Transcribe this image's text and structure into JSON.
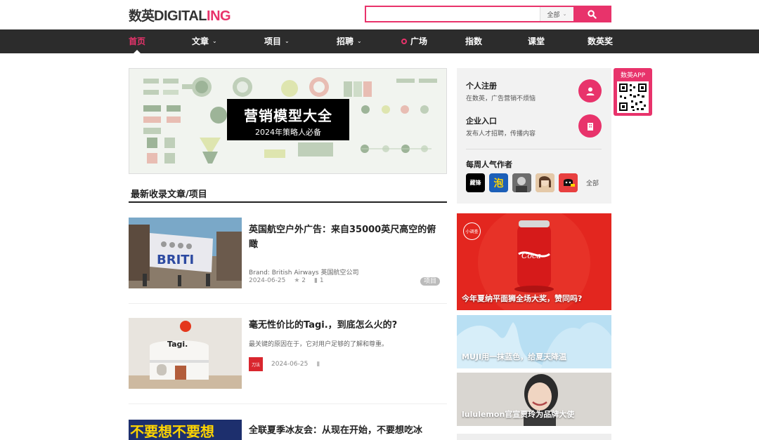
{
  "brand": {
    "logo_zh": "数英",
    "logo_en_a": "DIGITAL",
    "logo_en_b": "ING",
    "accent": "#e8336b"
  },
  "search": {
    "value": "",
    "placeholder": "",
    "scope": "全部"
  },
  "nav": [
    {
      "label": "首页",
      "active": true,
      "dropdown": false
    },
    {
      "label": "文章",
      "dropdown": true
    },
    {
      "label": "项目",
      "dropdown": true
    },
    {
      "label": "招聘",
      "dropdown": true
    },
    {
      "label": "广场",
      "dot": true
    },
    {
      "label": "指数"
    },
    {
      "label": "课堂"
    },
    {
      "label": "数英奖"
    }
  ],
  "banner": {
    "title": "营销模型大全",
    "subtitle": "2024年策略人必备"
  },
  "section_title": "最新收录文章/项目",
  "articles": [
    {
      "title": "英国航空户外广告：来自35000英尺高空的俯瞰",
      "brand_line": "Brand: British Airways 英国航空公司",
      "date": "2024-06-25",
      "likes": "2",
      "comments": "1",
      "tag": "项目"
    },
    {
      "title": "毫无性价比的Tagi.，到底怎么火的?",
      "excerpt": "最关键的原因在于，它对用户足够的了解和尊重。",
      "date": "2024-06-25",
      "source_logo": "刀法"
    },
    {
      "title": "全联夏季冰友会：从现在开始，不要想吃冰",
      "thumb_text": "不要想不要想"
    }
  ],
  "sidebar": {
    "register": {
      "title": "个人注册",
      "sub": "在数英，广告营销不烦恼"
    },
    "enterprise": {
      "title": "企业入口",
      "sub": "发布人才招聘，传播内容"
    },
    "authors_title": "每周人气作者",
    "authors": [
      "藏锋",
      "泡",
      "",
      "",
      ""
    ],
    "all_label": "全部",
    "app_label": "数英APP"
  },
  "promos": [
    {
      "caption": "今年夏纳平面狮全场大奖，赞同吗?",
      "badge": "小调查"
    },
    {
      "caption": "MUJI用一抹蓝色，给夏天降温"
    },
    {
      "caption": "lululemon官宣贾玲为品牌大使"
    }
  ]
}
